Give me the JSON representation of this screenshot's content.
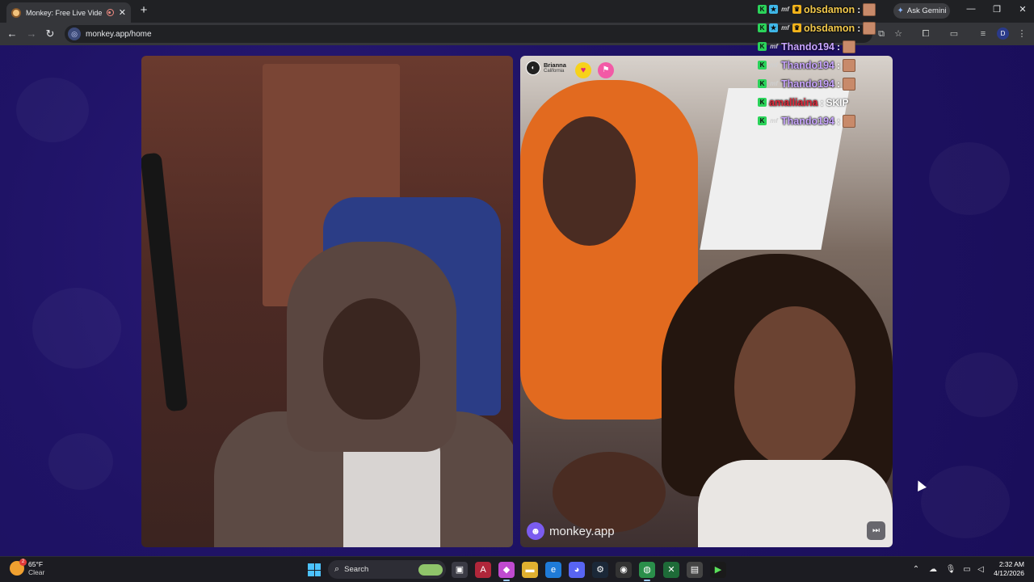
{
  "browser": {
    "tab_title": "Monkey: Free Live Video Ch",
    "url": "monkey.app/home",
    "gemini_label": "Ask Gemini",
    "profile_initial": "D"
  },
  "stranger": {
    "name": "Brianna",
    "location": "California"
  },
  "branding": {
    "name": "monkey.app"
  },
  "chat": [
    {
      "user": "obsdamon",
      "color": "#f2c94c",
      "badges": [
        "k",
        "p",
        "m",
        "c"
      ],
      "message": "",
      "emote": true
    },
    {
      "user": "obsdamon",
      "color": "#f2c94c",
      "badges": [
        "k",
        "p",
        "m",
        "c"
      ],
      "message": "",
      "emote": true
    },
    {
      "user": "Thando194",
      "color": "#c9a6ff",
      "badges": [
        "k",
        "m"
      ],
      "message": "",
      "emote": true
    },
    {
      "user": "Thando194",
      "color": "#c9a6ff",
      "badges": [
        "k",
        "m"
      ],
      "message": "",
      "emote": true
    },
    {
      "user": "Thando194",
      "color": "#c9a6ff",
      "badges": [
        "k",
        "m"
      ],
      "message": "",
      "emote": true
    },
    {
      "user": "amalliaina",
      "color": "#e0283a",
      "badges": [
        "k"
      ],
      "message": "SKIP",
      "emote": false
    },
    {
      "user": "Thando194",
      "color": "#c9a6ff",
      "badges": [
        "k",
        "m"
      ],
      "message": "",
      "emote": true
    }
  ],
  "taskbar": {
    "weather_temp": "65°F",
    "weather_condition": "Clear",
    "weather_badge": "2",
    "search_label": "Search",
    "time": "2:32 AM",
    "date": "4/12/2026"
  },
  "colors": {
    "page_bg": "#1b0f5c",
    "accent": "#7b5cf0"
  }
}
